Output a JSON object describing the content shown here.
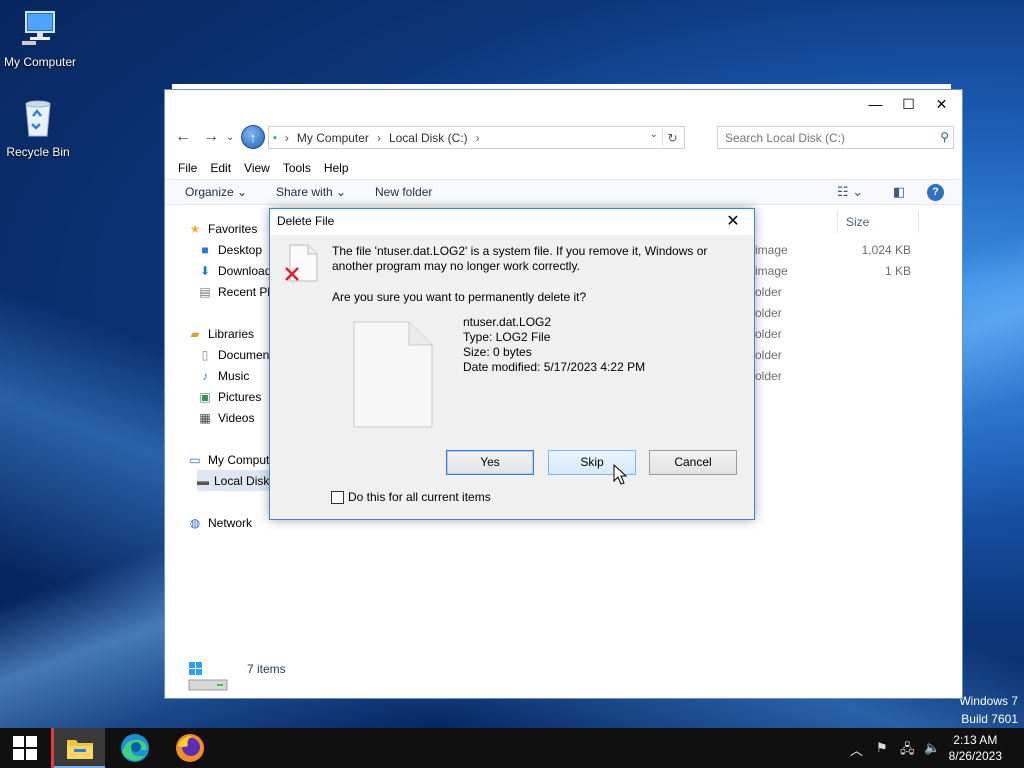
{
  "desktop": {
    "icons": [
      {
        "label": "My Computer",
        "icon": "computer-icon"
      },
      {
        "label": "Recycle Bin",
        "icon": "recycle-bin-icon"
      }
    ],
    "watermark_line1": "Windows 7",
    "watermark_line2": "Build 7601"
  },
  "explorer": {
    "controls": {
      "minimize": "—",
      "maximize": "☐",
      "close": "✕"
    },
    "address": {
      "crumbs": [
        "My Computer",
        "Local Disk (C:)"
      ]
    },
    "search": {
      "placeholder": "Search Local Disk (C:)"
    },
    "menu": [
      "File",
      "Edit",
      "View",
      "Tools",
      "Help"
    ],
    "commands": {
      "organize": "Organize ⌄",
      "share": "Share with ⌄",
      "new_folder": "New folder"
    },
    "nav": {
      "favorites": "Favorites",
      "desktop": "Desktop",
      "downloads": "Downloads",
      "recent": "Recent Places",
      "libraries": "Libraries",
      "documents": "Documents",
      "music": "Music",
      "pictures": "Pictures",
      "videos": "Videos",
      "computer": "My Computer",
      "local_disk": "Local Disk (C:)",
      "network": "Network"
    },
    "columns": {
      "size": "Size"
    },
    "rows": [
      {
        "type": "image",
        "size": "1,024 KB"
      },
      {
        "type": "image",
        "size": "1 KB"
      },
      {
        "type": "older",
        "size": ""
      },
      {
        "type": "older",
        "size": ""
      },
      {
        "type": "older",
        "size": ""
      },
      {
        "type": "older",
        "size": ""
      },
      {
        "type": "older",
        "size": ""
      }
    ],
    "status": {
      "count": "7 items"
    }
  },
  "dialog": {
    "title": "Delete File",
    "message": "The file 'ntuser.dat.LOG2' is a system file. If you remove it, Windows or another program may no longer work correctly.",
    "question": "Are you sure you want to permanently delete it?",
    "file": {
      "name": "ntuser.dat.LOG2",
      "type": "Type: LOG2 File",
      "size": "Size: 0 bytes",
      "modified": "Date modified: 5/17/2023 4:22 PM"
    },
    "buttons": {
      "yes": "Yes",
      "skip": "Skip",
      "cancel": "Cancel"
    },
    "checkbox_label": "Do this for all current items",
    "checkbox_checked": false
  },
  "taskbar": {
    "apps": [
      "file-explorer-icon",
      "edge-icon",
      "firefox-icon"
    ],
    "time": "2:13 AM",
    "date": "8/26/2023"
  },
  "colors": {
    "accent": "#3c7fd1",
    "taskbar": "#101010",
    "dialog_border": "#3d86d6"
  }
}
